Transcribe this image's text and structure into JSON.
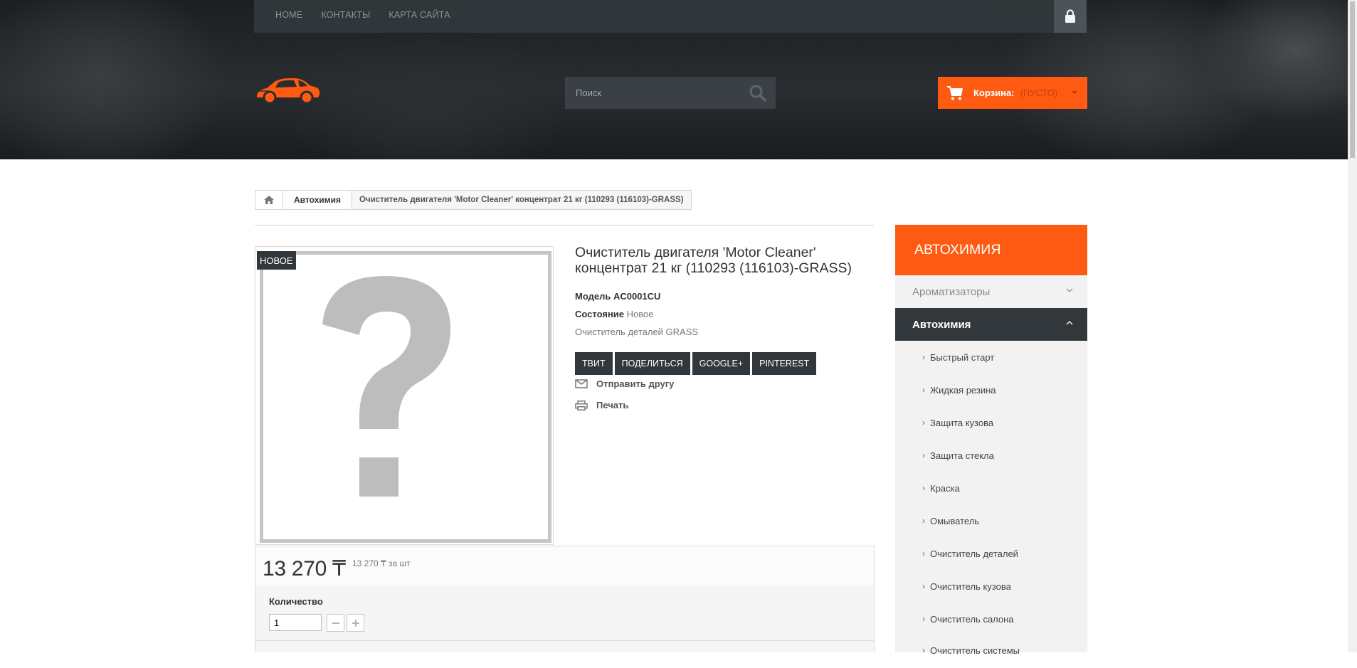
{
  "topbar": {
    "nav": [
      "HOME",
      "КОНТАКТЫ",
      "КАРТА САЙТА"
    ]
  },
  "search": {
    "placeholder": "Поиск"
  },
  "cart": {
    "label": "Корзина:",
    "status": "(ПУСТО)"
  },
  "breadcrumb": {
    "category": "Автохимия",
    "current": "Очиститель двигателя 'Motor Cleaner' концентрат 21 кг (110293 (116103)-GRASS)"
  },
  "product": {
    "badge": "НОВОЕ",
    "title": "Очиститель двигателя 'Motor Cleaner' концентрат 21 кг (110293 (116103)-GRASS)",
    "model_label": "Модель",
    "model_value": "AC0001CU",
    "condition_label": "Состояние",
    "condition_value": "Новое",
    "description": "Очиститель деталей GRASS",
    "share_buttons": [
      "ТВИТ",
      "ПОДЕЛИТЬСЯ",
      "GOOGLE+",
      "PINTEREST"
    ],
    "send_to_friend": "Отправить другу",
    "print": "Печать",
    "price": "13 270 ₸",
    "unit_price": "13 270 ₸ за шт",
    "quantity_label": "Количество",
    "quantity_value": "1"
  },
  "sidebar": {
    "title": "АВТОХИМИЯ",
    "items": [
      {
        "label": "Ароматизаторы",
        "expanded": false
      },
      {
        "label": "Автохимия",
        "expanded": true
      }
    ],
    "subitems": [
      "Быстрый старт",
      "Жидкая резина",
      "Защита кузова",
      "Защита стекла",
      "Краска",
      "Омыватель",
      "Очиститель деталей",
      "Очиститель кузова",
      "Очиститель салона",
      "Очиститель системы"
    ]
  },
  "colors": {
    "accent": "#ff5a12",
    "dark": "#32373b"
  }
}
